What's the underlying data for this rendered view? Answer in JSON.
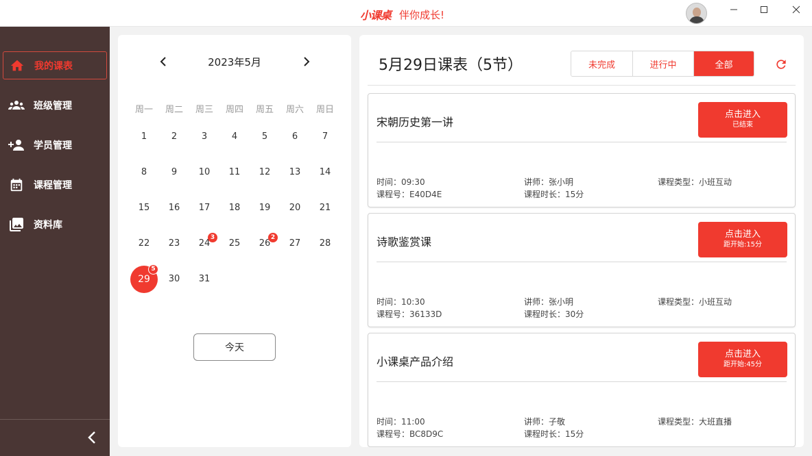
{
  "header": {
    "logo": "小课桌",
    "slogan": "伴你成长!",
    "window_controls": {
      "minimize": "—",
      "maximize": "☐",
      "close": "✕"
    }
  },
  "sidebar": {
    "items": [
      {
        "label": "我的课表",
        "icon": "home-icon",
        "active": true
      },
      {
        "label": "班级管理",
        "icon": "group-icon",
        "active": false
      },
      {
        "label": "学员管理",
        "icon": "add-user-icon",
        "active": false
      },
      {
        "label": "课程管理",
        "icon": "calendar-icon",
        "active": false
      },
      {
        "label": "资料库",
        "icon": "photo-library-icon",
        "active": false
      }
    ],
    "collapse_icon": "chevron-left-icon"
  },
  "calendar": {
    "title": "2023年5月",
    "weekdays": [
      "周一",
      "周二",
      "周三",
      "周四",
      "周五",
      "周六",
      "周日"
    ],
    "weeks": [
      [
        "1",
        "2",
        "3",
        "4",
        "5",
        "6",
        "7"
      ],
      [
        "8",
        "9",
        "10",
        "11",
        "12",
        "13",
        "14"
      ],
      [
        "15",
        "16",
        "17",
        "18",
        "19",
        "20",
        "21"
      ],
      [
        "22",
        "23",
        "24",
        "25",
        "26",
        "27",
        "28"
      ],
      [
        "29",
        "30",
        "31",
        "",
        "",
        "",
        ""
      ]
    ],
    "selected_day": "29",
    "badges": {
      "24": "3",
      "26": "2",
      "29": "5"
    },
    "today_label": "今天"
  },
  "schedule": {
    "title": "5月29日课表（5节）",
    "filters": [
      {
        "label": "未完成",
        "active": false
      },
      {
        "label": "进行中",
        "active": false
      },
      {
        "label": "全部",
        "active": true
      }
    ],
    "refresh_icon": "refresh-icon",
    "accent": "#f03a2f",
    "courses": [
      {
        "name": "宋朝历史第一讲",
        "button_main": "点击进入",
        "button_sub": "已结束",
        "time": "时间：09:30",
        "code": "课程号：E40D4E",
        "teacher": "讲师：张小明",
        "duration": "课程时长：15分",
        "type": "课程类型：小班互动"
      },
      {
        "name": "诗歌鉴赏课",
        "button_main": "点击进入",
        "button_sub": "距开始:15分",
        "time": "时间：10:30",
        "code": "课程号：36133D",
        "teacher": "讲师：张小明",
        "duration": "课程时长：30分",
        "type": "课程类型：小班互动"
      },
      {
        "name": "小课桌产品介绍",
        "button_main": "点击进入",
        "button_sub": "距开始:45分",
        "time": "时间：11:00",
        "code": "课程号：BC8D9C",
        "teacher": "讲师：子敬",
        "duration": "课程时长：15分",
        "type": "课程类型：大班直播"
      }
    ]
  }
}
